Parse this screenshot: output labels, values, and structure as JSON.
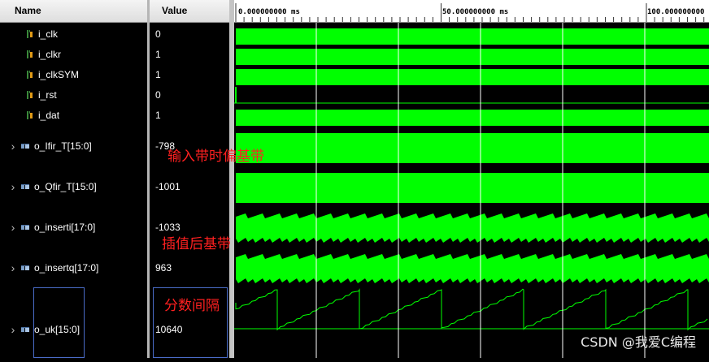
{
  "headers": {
    "name": "Name",
    "value": "Value"
  },
  "timeline": {
    "ticks": [
      "0.000000000 ms",
      "50.000000000 ms",
      "100.000000000"
    ]
  },
  "signals": [
    {
      "name": "i_clk",
      "value": "0",
      "kind": "bit"
    },
    {
      "name": "i_clkr",
      "value": "1",
      "kind": "bit"
    },
    {
      "name": "i_clkSYM",
      "value": "1",
      "kind": "bit"
    },
    {
      "name": "i_rst",
      "value": "0",
      "kind": "bit"
    },
    {
      "name": "i_dat",
      "value": "1",
      "kind": "bit"
    },
    {
      "name": "o_Ifir_T[15:0]",
      "value": "-798",
      "kind": "bus"
    },
    {
      "name": "o_Qfir_T[15:0]",
      "value": "-1001",
      "kind": "bus"
    },
    {
      "name": "o_inserti[17:0]",
      "value": "-1033",
      "kind": "bus"
    },
    {
      "name": "o_insertq[17:0]",
      "value": "963",
      "kind": "bus"
    },
    {
      "name": "o_uk[15:0]",
      "value": "10640",
      "kind": "bus"
    }
  ],
  "annotations": {
    "baseband": "输入带时偏基带",
    "interpolated": "插值后基带",
    "fraction": "分数间隔"
  },
  "watermark": "CSDN @我爱C编程",
  "colors": {
    "wave": "#00ff00",
    "grid": "#ffffff",
    "annotation": "#ff2020"
  },
  "icons": {
    "bit": "bit-signal-icon",
    "bus": "bus-signal-icon",
    "expander": "chevron-right-icon"
  }
}
